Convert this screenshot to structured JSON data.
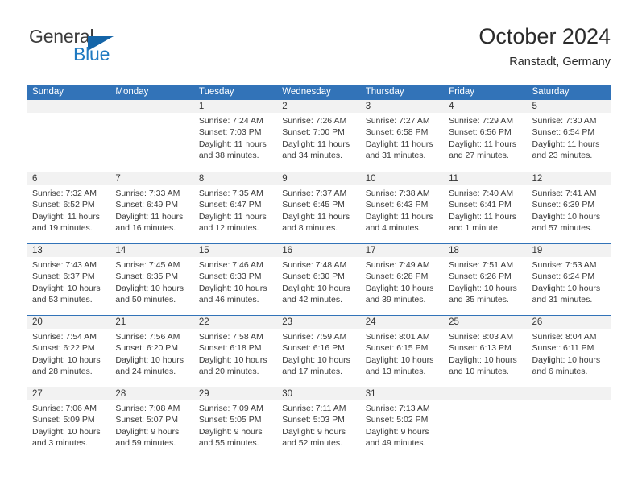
{
  "brand": {
    "name_part1": "General",
    "name_part2": "Blue",
    "logo_icon": "triangle-mark",
    "color_dark": "#3c3c3c",
    "color_blue": "#1f7ac1"
  },
  "header": {
    "title": "October 2024",
    "subtitle": "Ranstadt, Germany"
  },
  "theme": {
    "header_blue": "#3273b8",
    "day_band_gray": "#f2f2f2",
    "text": "#333333"
  },
  "weekdays": [
    "Sunday",
    "Monday",
    "Tuesday",
    "Wednesday",
    "Thursday",
    "Friday",
    "Saturday"
  ],
  "weeks": [
    [
      {
        "day": "",
        "sunrise": "",
        "sunset": "",
        "daylight_line1": "",
        "daylight_line2": "",
        "empty": true
      },
      {
        "day": "",
        "sunrise": "",
        "sunset": "",
        "daylight_line1": "",
        "daylight_line2": "",
        "empty": true
      },
      {
        "day": "1",
        "sunrise": "Sunrise: 7:24 AM",
        "sunset": "Sunset: 7:03 PM",
        "daylight_line1": "Daylight: 11 hours",
        "daylight_line2": "and 38 minutes."
      },
      {
        "day": "2",
        "sunrise": "Sunrise: 7:26 AM",
        "sunset": "Sunset: 7:00 PM",
        "daylight_line1": "Daylight: 11 hours",
        "daylight_line2": "and 34 minutes."
      },
      {
        "day": "3",
        "sunrise": "Sunrise: 7:27 AM",
        "sunset": "Sunset: 6:58 PM",
        "daylight_line1": "Daylight: 11 hours",
        "daylight_line2": "and 31 minutes."
      },
      {
        "day": "4",
        "sunrise": "Sunrise: 7:29 AM",
        "sunset": "Sunset: 6:56 PM",
        "daylight_line1": "Daylight: 11 hours",
        "daylight_line2": "and 27 minutes."
      },
      {
        "day": "5",
        "sunrise": "Sunrise: 7:30 AM",
        "sunset": "Sunset: 6:54 PM",
        "daylight_line1": "Daylight: 11 hours",
        "daylight_line2": "and 23 minutes."
      }
    ],
    [
      {
        "day": "6",
        "sunrise": "Sunrise: 7:32 AM",
        "sunset": "Sunset: 6:52 PM",
        "daylight_line1": "Daylight: 11 hours",
        "daylight_line2": "and 19 minutes."
      },
      {
        "day": "7",
        "sunrise": "Sunrise: 7:33 AM",
        "sunset": "Sunset: 6:49 PM",
        "daylight_line1": "Daylight: 11 hours",
        "daylight_line2": "and 16 minutes."
      },
      {
        "day": "8",
        "sunrise": "Sunrise: 7:35 AM",
        "sunset": "Sunset: 6:47 PM",
        "daylight_line1": "Daylight: 11 hours",
        "daylight_line2": "and 12 minutes."
      },
      {
        "day": "9",
        "sunrise": "Sunrise: 7:37 AM",
        "sunset": "Sunset: 6:45 PM",
        "daylight_line1": "Daylight: 11 hours",
        "daylight_line2": "and 8 minutes."
      },
      {
        "day": "10",
        "sunrise": "Sunrise: 7:38 AM",
        "sunset": "Sunset: 6:43 PM",
        "daylight_line1": "Daylight: 11 hours",
        "daylight_line2": "and 4 minutes."
      },
      {
        "day": "11",
        "sunrise": "Sunrise: 7:40 AM",
        "sunset": "Sunset: 6:41 PM",
        "daylight_line1": "Daylight: 11 hours",
        "daylight_line2": "and 1 minute."
      },
      {
        "day": "12",
        "sunrise": "Sunrise: 7:41 AM",
        "sunset": "Sunset: 6:39 PM",
        "daylight_line1": "Daylight: 10 hours",
        "daylight_line2": "and 57 minutes."
      }
    ],
    [
      {
        "day": "13",
        "sunrise": "Sunrise: 7:43 AM",
        "sunset": "Sunset: 6:37 PM",
        "daylight_line1": "Daylight: 10 hours",
        "daylight_line2": "and 53 minutes."
      },
      {
        "day": "14",
        "sunrise": "Sunrise: 7:45 AM",
        "sunset": "Sunset: 6:35 PM",
        "daylight_line1": "Daylight: 10 hours",
        "daylight_line2": "and 50 minutes."
      },
      {
        "day": "15",
        "sunrise": "Sunrise: 7:46 AM",
        "sunset": "Sunset: 6:33 PM",
        "daylight_line1": "Daylight: 10 hours",
        "daylight_line2": "and 46 minutes."
      },
      {
        "day": "16",
        "sunrise": "Sunrise: 7:48 AM",
        "sunset": "Sunset: 6:30 PM",
        "daylight_line1": "Daylight: 10 hours",
        "daylight_line2": "and 42 minutes."
      },
      {
        "day": "17",
        "sunrise": "Sunrise: 7:49 AM",
        "sunset": "Sunset: 6:28 PM",
        "daylight_line1": "Daylight: 10 hours",
        "daylight_line2": "and 39 minutes."
      },
      {
        "day": "18",
        "sunrise": "Sunrise: 7:51 AM",
        "sunset": "Sunset: 6:26 PM",
        "daylight_line1": "Daylight: 10 hours",
        "daylight_line2": "and 35 minutes."
      },
      {
        "day": "19",
        "sunrise": "Sunrise: 7:53 AM",
        "sunset": "Sunset: 6:24 PM",
        "daylight_line1": "Daylight: 10 hours",
        "daylight_line2": "and 31 minutes."
      }
    ],
    [
      {
        "day": "20",
        "sunrise": "Sunrise: 7:54 AM",
        "sunset": "Sunset: 6:22 PM",
        "daylight_line1": "Daylight: 10 hours",
        "daylight_line2": "and 28 minutes."
      },
      {
        "day": "21",
        "sunrise": "Sunrise: 7:56 AM",
        "sunset": "Sunset: 6:20 PM",
        "daylight_line1": "Daylight: 10 hours",
        "daylight_line2": "and 24 minutes."
      },
      {
        "day": "22",
        "sunrise": "Sunrise: 7:58 AM",
        "sunset": "Sunset: 6:18 PM",
        "daylight_line1": "Daylight: 10 hours",
        "daylight_line2": "and 20 minutes."
      },
      {
        "day": "23",
        "sunrise": "Sunrise: 7:59 AM",
        "sunset": "Sunset: 6:16 PM",
        "daylight_line1": "Daylight: 10 hours",
        "daylight_line2": "and 17 minutes."
      },
      {
        "day": "24",
        "sunrise": "Sunrise: 8:01 AM",
        "sunset": "Sunset: 6:15 PM",
        "daylight_line1": "Daylight: 10 hours",
        "daylight_line2": "and 13 minutes."
      },
      {
        "day": "25",
        "sunrise": "Sunrise: 8:03 AM",
        "sunset": "Sunset: 6:13 PM",
        "daylight_line1": "Daylight: 10 hours",
        "daylight_line2": "and 10 minutes."
      },
      {
        "day": "26",
        "sunrise": "Sunrise: 8:04 AM",
        "sunset": "Sunset: 6:11 PM",
        "daylight_line1": "Daylight: 10 hours",
        "daylight_line2": "and 6 minutes."
      }
    ],
    [
      {
        "day": "27",
        "sunrise": "Sunrise: 7:06 AM",
        "sunset": "Sunset: 5:09 PM",
        "daylight_line1": "Daylight: 10 hours",
        "daylight_line2": "and 3 minutes."
      },
      {
        "day": "28",
        "sunrise": "Sunrise: 7:08 AM",
        "sunset": "Sunset: 5:07 PM",
        "daylight_line1": "Daylight: 9 hours",
        "daylight_line2": "and 59 minutes."
      },
      {
        "day": "29",
        "sunrise": "Sunrise: 7:09 AM",
        "sunset": "Sunset: 5:05 PM",
        "daylight_line1": "Daylight: 9 hours",
        "daylight_line2": "and 55 minutes."
      },
      {
        "day": "30",
        "sunrise": "Sunrise: 7:11 AM",
        "sunset": "Sunset: 5:03 PM",
        "daylight_line1": "Daylight: 9 hours",
        "daylight_line2": "and 52 minutes."
      },
      {
        "day": "31",
        "sunrise": "Sunrise: 7:13 AM",
        "sunset": "Sunset: 5:02 PM",
        "daylight_line1": "Daylight: 9 hours",
        "daylight_line2": "and 49 minutes."
      },
      {
        "day": "",
        "sunrise": "",
        "sunset": "",
        "daylight_line1": "",
        "daylight_line2": "",
        "empty": true
      },
      {
        "day": "",
        "sunrise": "",
        "sunset": "",
        "daylight_line1": "",
        "daylight_line2": "",
        "empty": true
      }
    ]
  ]
}
